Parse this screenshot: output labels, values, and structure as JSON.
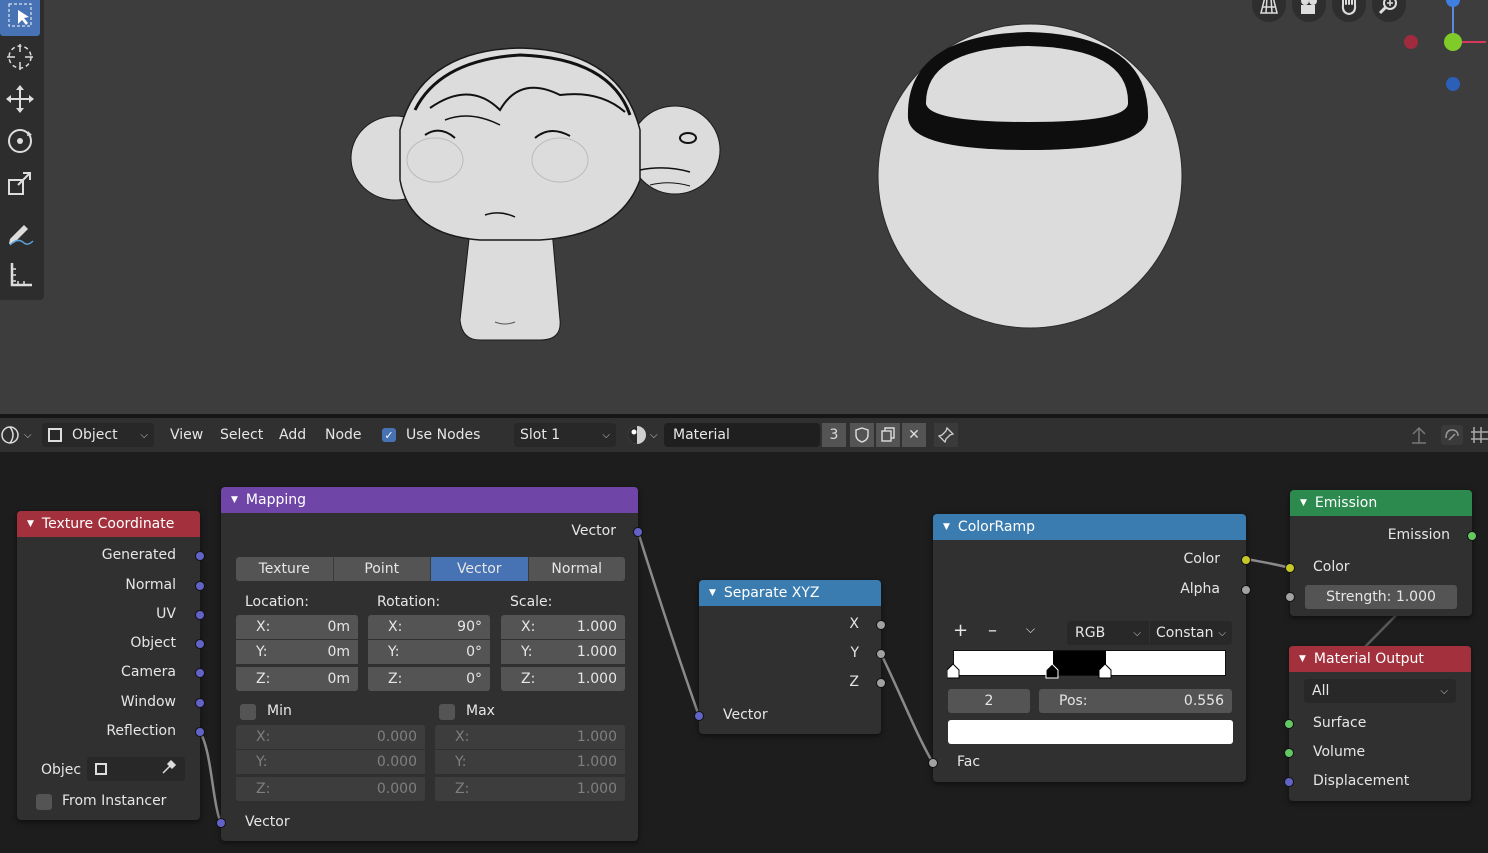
{
  "header": {
    "editor_mode": "Object",
    "menus": [
      "View",
      "Select",
      "Add",
      "Node"
    ],
    "use_nodes_label": "Use Nodes",
    "slot": "Slot 1",
    "material_name": "Material",
    "user_count": "3"
  },
  "nodes": {
    "texcoord": {
      "title": "Texture Coordinate",
      "outputs": [
        "Generated",
        "Normal",
        "UV",
        "Object",
        "Camera",
        "Window",
        "Reflection"
      ],
      "object_label": "Objec",
      "from_instancer": "From Instancer"
    },
    "mapping": {
      "title": "Mapping",
      "output": "Vector",
      "types": [
        "Texture",
        "Point",
        "Vector",
        "Normal"
      ],
      "active_type": "Vector",
      "location_label": "Location:",
      "rotation_label": "Rotation:",
      "scale_label": "Scale:",
      "location": {
        "x": "0m",
        "y": "0m",
        "z": "0m"
      },
      "rotation": {
        "x": "90°",
        "y": "0°",
        "z": "0°"
      },
      "scale": {
        "x": "1.000",
        "y": "1.000",
        "z": "1.000"
      },
      "axis_x": "X:",
      "axis_y": "Y:",
      "axis_z": "Z:",
      "min_label": "Min",
      "max_label": "Max",
      "min": {
        "x": "0.000",
        "y": "0.000",
        "z": "0.000"
      },
      "max": {
        "x": "1.000",
        "y": "1.000",
        "z": "1.000"
      },
      "input": "Vector"
    },
    "separate": {
      "title": "Separate XYZ",
      "outputs": [
        "X",
        "Y",
        "Z"
      ],
      "input": "Vector"
    },
    "colorramp": {
      "title": "ColorRamp",
      "outputs": [
        "Color",
        "Alpha"
      ],
      "add": "+",
      "remove": "–",
      "color_mode": "RGB",
      "interpolation": "Constan",
      "active_index": "2",
      "pos_label": "Pos:",
      "pos_value": "0.556",
      "input": "Fac"
    },
    "emission": {
      "title": "Emission",
      "output": "Emission",
      "color_input": "Color",
      "strength": "Strength:  1.000"
    },
    "output": {
      "title": "Material Output",
      "target": "All",
      "inputs": [
        "Surface",
        "Volume",
        "Displacement"
      ]
    }
  },
  "colors": {
    "vector_socket": "#6363c7",
    "color_socket": "#c7c729",
    "shader_socket": "#63c763",
    "input_header": "#a3313d",
    "vector_header": "#6f45a8",
    "converter_header": "#3a7cb0",
    "shader_header": "#2d8a4f",
    "output_header": "#a3313d",
    "accent": "#4772b3"
  }
}
